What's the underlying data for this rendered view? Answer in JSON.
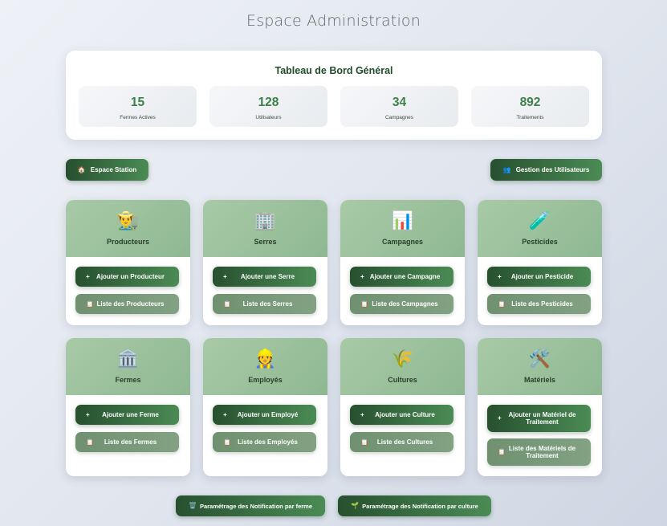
{
  "page": {
    "title": "Espace Administration"
  },
  "dashboard": {
    "title": "Tableau de Bord Général",
    "stats": [
      {
        "value": "15",
        "label": "Fermes Actives"
      },
      {
        "value": "128",
        "label": "Utilisateurs"
      },
      {
        "value": "34",
        "label": "Campagnes"
      },
      {
        "value": "892",
        "label": "Traitements"
      }
    ]
  },
  "nav": {
    "station": {
      "icon": "home-icon",
      "glyph": "🏠",
      "label": "Espace Station"
    },
    "users": {
      "icon": "users-icon",
      "glyph": "👥",
      "label": "Gestion des Utilisateurs"
    }
  },
  "cards": [
    {
      "icon": "farmer-icon",
      "glyph": "👨‍🌾",
      "title": "Producteurs",
      "add": "Ajouter un Producteur",
      "list": "Liste des Producteurs"
    },
    {
      "icon": "building-icon",
      "glyph": "🏢",
      "title": "Serres",
      "add": "Ajouter une Serre",
      "list": "Liste des Serres"
    },
    {
      "icon": "chart-icon",
      "glyph": "📊",
      "title": "Campagnes",
      "add": "Ajouter une Campagne",
      "list": "Liste des Campagnes"
    },
    {
      "icon": "test-tube-icon",
      "glyph": "🧪",
      "title": "Pesticides",
      "add": "Ajouter un Pesticide",
      "list": "Liste des Pesticides"
    },
    {
      "icon": "bank-icon",
      "glyph": "🏛️",
      "title": "Fermes",
      "add": "Ajouter une Ferme",
      "list": "Liste des Fermes"
    },
    {
      "icon": "worker-icon",
      "glyph": "👷",
      "title": "Employés",
      "add": "Ajouter un Employé",
      "list": "Liste des Employés"
    },
    {
      "icon": "plant-icon",
      "glyph": "🌾",
      "title": "Cultures",
      "add": "Ajouter une Culture",
      "list": "Liste des Cultures"
    },
    {
      "icon": "tools-icon",
      "glyph": "🛠️",
      "title": "Matériels",
      "add": "Ajouter un Matériel de Traitement",
      "list": "Liste des Matériels de Traitement"
    }
  ],
  "buttons": {
    "add_icon": "plus-icon",
    "add_glyph": "+",
    "list_icon": "clipboard-icon",
    "list_glyph": "📋"
  },
  "footer": {
    "farm_notif": {
      "icon": "trash-icon",
      "glyph": "🗑️",
      "label": "Paramétrage des Notification par ferme"
    },
    "culture_notif": {
      "icon": "seedling-icon",
      "glyph": "🌱",
      "label": "Paramétrage des Notification par culture"
    }
  }
}
